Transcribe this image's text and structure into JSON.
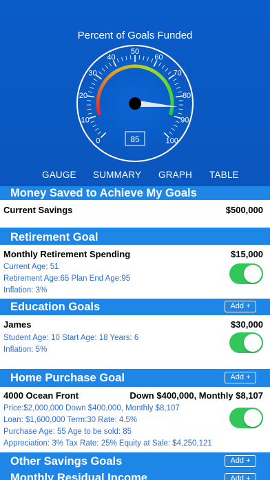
{
  "gauge": {
    "title": "Percent of Goals Funded",
    "value": 85,
    "value_display": "85",
    "ticks": [
      "0",
      "10",
      "20",
      "30",
      "40",
      "50",
      "60",
      "70",
      "80",
      "90",
      "100"
    ]
  },
  "tabs": [
    "GAUGE",
    "SUMMARY",
    "GRAPH",
    "TABLE"
  ],
  "sections": {
    "money_saved": {
      "header": "Money Saved to Achieve My Goals",
      "row_label": "Current Savings",
      "row_amount": "$500,000"
    },
    "retirement": {
      "header": "Retirement Goal",
      "row_label": "Monthly Retirement Spending",
      "row_amount": "$15,000",
      "details": [
        "Current Age: 51",
        "Retirement Age:65 Plan End Age:95",
        "Inflation: 3%"
      ]
    },
    "education": {
      "header": "Education Goals",
      "add_label": "Add +",
      "row_label": "James",
      "row_amount": "$30,000",
      "details": [
        "Student Age: 10 Start Age: 18 Years: 6",
        "Inflation: 5%"
      ]
    },
    "home": {
      "header": "Home Purchase Goal",
      "add_label": "Add +",
      "row_label": "4000  Ocean Front",
      "row_amount": "Down $400,000, Monthly $8,107",
      "details": [
        "Price:$2,000,000 Down $400,000, Monthly $8,107",
        "Loan: $1,600,000 Term:30 Rate: 4.5%",
        "Purchase Age: 55 Age to be sold: 85",
        "Appreciation: 3% Tax Rate: 25% Equity at Sale: $4,250,121"
      ]
    },
    "other_savings": {
      "header": "Other Savings Goals",
      "add_label": "Add +"
    },
    "residual": {
      "header": "Monthly Residual Income",
      "add_label": "Add +"
    }
  },
  "colors": {
    "panel_blue": "#0a5cc9",
    "section_blue": "#1e86e6",
    "detail_blue": "#2b6fd6",
    "toggle_green": "#33c759"
  }
}
